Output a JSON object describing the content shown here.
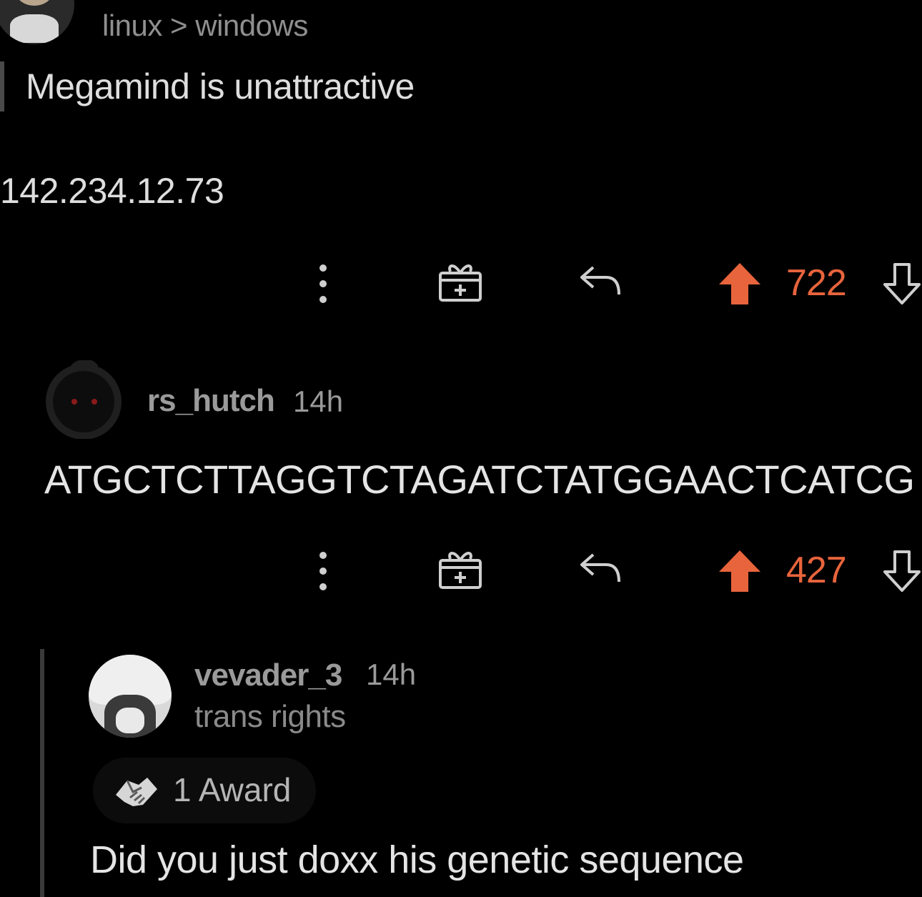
{
  "comment_1": {
    "flair": "linux > windows",
    "body_line_1": "Megamind is unattractive",
    "body_line_2": "142.234.12.73",
    "actions": {
      "more_icon": "more-vertical-icon",
      "gift_icon": "gift-icon",
      "reply_icon": "reply-icon",
      "upvote_icon": "upvote-arrow-icon",
      "score": "722",
      "downvote_icon": "downvote-arrow-icon"
    }
  },
  "comment_2": {
    "username": "rs_hutch",
    "time": "14h",
    "body": "ATGCTCTTAGGTCTAGATCTATGGAACTCATCG",
    "actions": {
      "more_icon": "more-vertical-icon",
      "gift_icon": "gift-icon",
      "reply_icon": "reply-icon",
      "upvote_icon": "upvote-arrow-icon",
      "score": "427",
      "downvote_icon": "downvote-arrow-icon"
    }
  },
  "comment_3": {
    "username": "vevader_3",
    "time": "14h",
    "flair": "trans rights",
    "award_icon": "handshake-award-icon",
    "award_label": "1 Award",
    "body": "Did you just doxx his genetic sequence"
  },
  "colors": {
    "background": "#000000",
    "upvote_active": "#e8643c",
    "text_primary": "#e4e4e4",
    "text_muted": "#9a9a9a"
  }
}
